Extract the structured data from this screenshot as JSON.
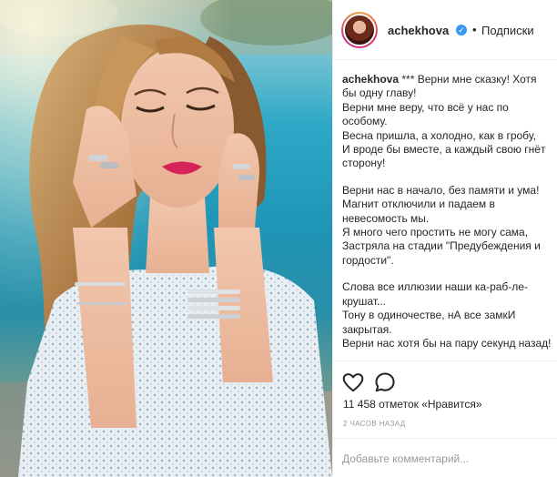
{
  "post": {
    "username": "achekhova",
    "verified_mark": "✓",
    "separator": "•",
    "follow_label": "Подписки"
  },
  "caption": {
    "username": "achekhova",
    "paragraphs": [
      "*** Верни мне сказку! Хотя бы одну главу!\nВерни мне веру, что всё у нас по особому.\nВесна пришла, а холодно, как в гробу,\nИ вроде бы вместе, а каждый свою гнёт сторону!",
      "Верни нас в начало, без памяти и ума!\nМагнит отключили и падаем в невесомость мы.\nЯ много чего простить не могу сама,\nЗастряла на стадии \"Предубеждения и гордости\".",
      "Слова все иллюзии наши ка-раб-ле-крушат...\nТону в одиночестве, нА все замкИ закрытая.\nВерни нас хотя бы на пару секунд назад!"
    ]
  },
  "actions": {
    "like_icon": "heart-icon",
    "comment_icon": "comment-bubble-icon",
    "likes_text": "11 458 отметок «Нравится»",
    "time_ago": "2 ЧАСОВ НАЗАД"
  },
  "comment": {
    "placeholder": "Добавьте комментарий..."
  },
  "colors": {
    "verified": "#3897f0",
    "text": "#262626",
    "muted": "#999999",
    "border": "#efefef"
  }
}
